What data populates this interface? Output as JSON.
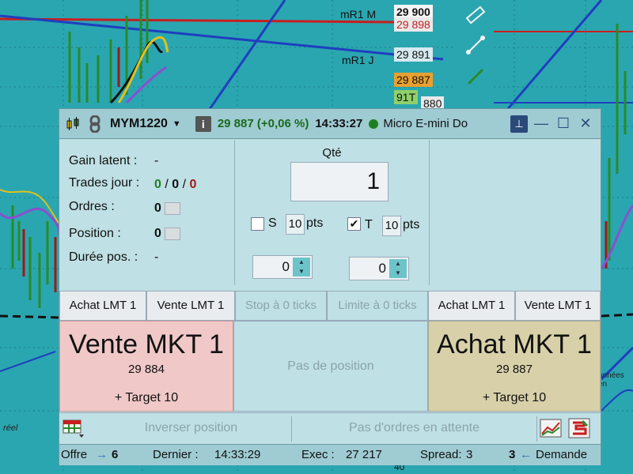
{
  "background": {
    "price_labels": [
      "mR1 M",
      "29 900",
      "29 898",
      "mR1 J",
      "29 891",
      "29 887",
      "91T",
      "880",
      "40"
    ],
    "left_label": "réel",
    "right_label": "onnées en",
    "colors": {
      "bg": "#2aa6b0",
      "red_line": "#c81e1e",
      "blue_line": "#1f3fbf",
      "green_bar": "#2a8a2a"
    }
  },
  "window": {
    "title": {
      "symbol": "MYM1220",
      "quote": "29 887 (+0,06 %)",
      "time": "14:33:27",
      "instrument": "Micro E-mini Do"
    },
    "stats": {
      "latent_label": "Gain latent :",
      "latent_value": "-",
      "trades_label": "Trades jour :",
      "trades_a": "0",
      "trades_sep1": "/",
      "trades_b": "0",
      "trades_sep2": "/",
      "trades_c": "0",
      "orders_label": "Ordres :",
      "orders_value": "0",
      "position_label": "Position :",
      "position_value": "0",
      "duration_label": "Durée pos. :",
      "duration_value": "-"
    },
    "qty": {
      "label": "Qté",
      "value": "1",
      "stop_label": "S",
      "stop_pts": "10",
      "stop_unit": "pts",
      "stop_checked": "",
      "target_label": "T",
      "target_pts": "10",
      "target_unit": "pts",
      "target_checked": "✔",
      "spin_left": "0",
      "spin_right": "0"
    },
    "buttons": {
      "buy_lmt_left": "Achat LMT 1",
      "sell_lmt_left": "Vente LMT 1",
      "stop_ticks": "Stop à 0 ticks",
      "limit_ticks": "Limite à 0 ticks",
      "buy_lmt_right": "Achat LMT 1",
      "sell_lmt_right": "Vente LMT 1"
    },
    "sell_market": {
      "title": "Vente MKT 1",
      "price": "29 884",
      "target": "+ Target 10",
      "color": "#f0c8c8"
    },
    "no_position": "Pas de position",
    "buy_market": {
      "title": "Achat MKT 1",
      "price": "29 887",
      "target": "+ Target 10",
      "color": "#d8d0a8"
    },
    "actions": {
      "reverse": "Inverser position",
      "pending": "Pas d'ordres en attente"
    },
    "status": {
      "offer_label": "Offre",
      "offer_value": "6",
      "last_label": "Dernier :",
      "last_value": "14:33:29",
      "exec_label": "Exec :",
      "exec_value": "27 217",
      "spread_label": "Spread:",
      "spread_value": "3",
      "demand_value": "3",
      "demand_label": "Demande"
    }
  }
}
